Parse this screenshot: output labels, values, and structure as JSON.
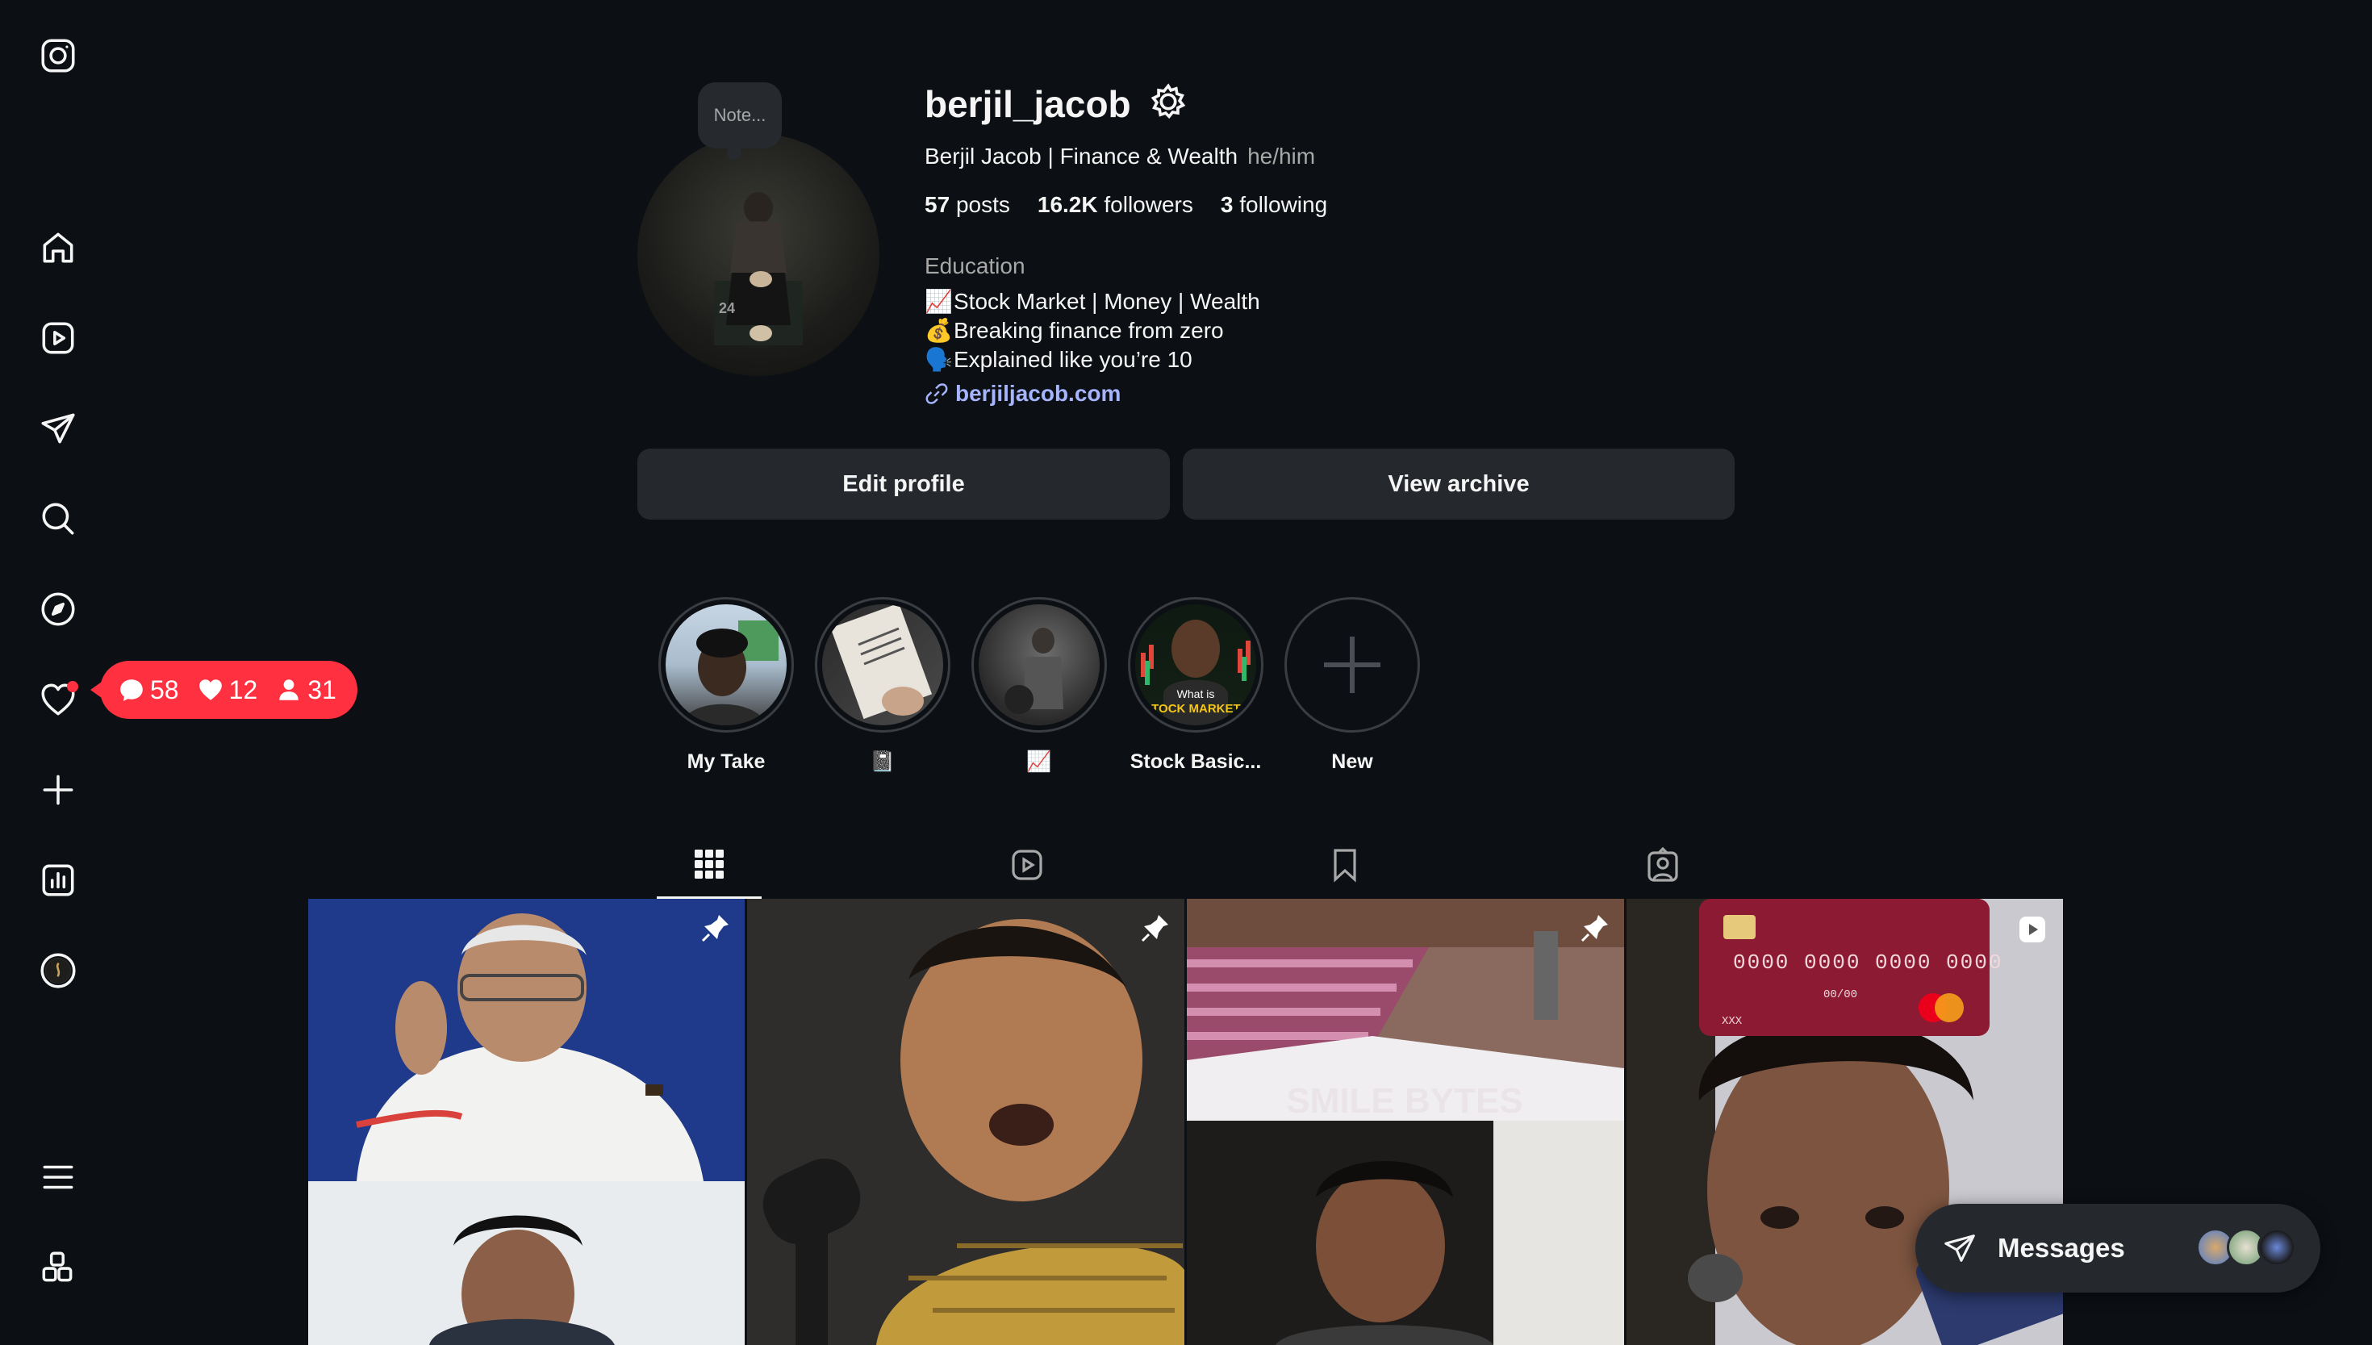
{
  "sidebar": {
    "logo": "instagram-icon",
    "items": [
      {
        "name": "home",
        "icon": "home-icon"
      },
      {
        "name": "reels",
        "icon": "reels-icon"
      },
      {
        "name": "messages",
        "icon": "send-icon"
      },
      {
        "name": "search",
        "icon": "search-icon"
      },
      {
        "name": "explore",
        "icon": "compass-icon"
      },
      {
        "name": "notifications",
        "icon": "heart-icon"
      },
      {
        "name": "create",
        "icon": "plus-icon"
      },
      {
        "name": "dashboard",
        "icon": "insights-icon"
      },
      {
        "name": "profile",
        "icon": "profile-avatar"
      }
    ],
    "more": "menu-icon",
    "also_from_meta": "apps-icon"
  },
  "notifications_pill": {
    "comments": "58",
    "likes": "12",
    "follows": "31",
    "color": "#ff3040"
  },
  "profile": {
    "note_placeholder": "Note...",
    "username": "berjil_jacob",
    "full_name": "Berjil Jacob | Finance & Wealth",
    "pronouns": "he/him",
    "posts_count": "57",
    "posts_label": "posts",
    "followers_count": "16.2K",
    "followers_label": "followers",
    "following_count": "3",
    "following_label": "following",
    "category": "Education",
    "bio": [
      {
        "emoji": "📈",
        "text": "Stock Market | Money | Wealth"
      },
      {
        "emoji": "💰",
        "text": "Breaking finance from zero"
      },
      {
        "emoji": "🗣️",
        "text": "Explained like you’re 10"
      }
    ],
    "link": "berjiljacob.com",
    "link_color": "#a5b4fc"
  },
  "actions": {
    "edit_profile": "Edit profile",
    "view_archive": "View archive"
  },
  "highlights": [
    {
      "label": "My Take"
    },
    {
      "label": "📓"
    },
    {
      "label": "📈"
    },
    {
      "label": "Stock Basic..."
    },
    {
      "label": "New"
    }
  ],
  "highlight_overlay_text": {
    "line1": "What is",
    "line2": "STOCK MARKET?"
  },
  "tabs": [
    {
      "name": "posts",
      "icon": "grid-icon",
      "active": true
    },
    {
      "name": "reels",
      "icon": "reels-icon",
      "active": false
    },
    {
      "name": "saved",
      "icon": "bookmark-icon",
      "active": false
    },
    {
      "name": "tagged",
      "icon": "tagged-icon",
      "active": false
    }
  ],
  "grid_posts": [
    {
      "pinned": true
    },
    {
      "pinned": true
    },
    {
      "pinned": true,
      "overlay_text": "SMILE BYTES"
    },
    {
      "pinned": false,
      "reel": true,
      "card_number": "0000 0000 0000 0000",
      "card_expiry": "00/00",
      "card_holder": "XXX"
    }
  ],
  "messages_widget": {
    "label": "Messages"
  }
}
